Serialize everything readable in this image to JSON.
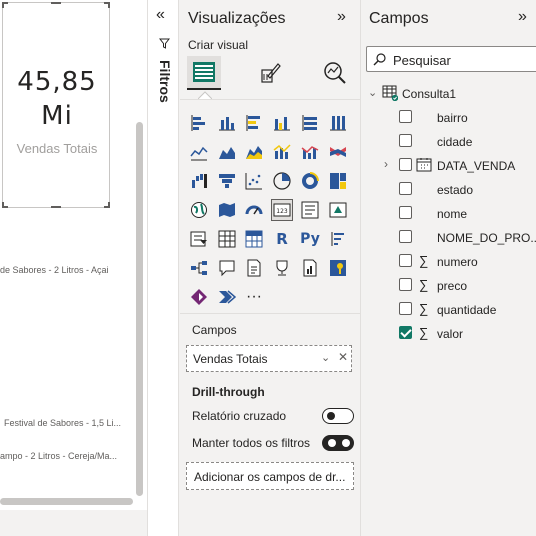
{
  "card": {
    "value_line1": "45,85",
    "value_line2": "Mi",
    "label": "Vendas Totais"
  },
  "chart_labels": [
    "de Sabores - 2 Litros - Açai",
    "Festival de Sabores - 1,5 Li...",
    "ampo - 2 Litros - Cereja/Ma..."
  ],
  "filters": {
    "label": "Filtros",
    "collapse_icon": "double-chevron-left-icon",
    "funnel_icon": "filter-icon"
  },
  "visualizations": {
    "title": "Visualizações",
    "build_label": "Criar visual",
    "wells_label": "Campos",
    "field_in_well": "Vendas Totais",
    "drill_title": "Drill-through",
    "cross_report_label": "Relatório cruzado",
    "cross_report_on": false,
    "keep_filters_label": "Manter todos os filtros",
    "keep_filters_on": true,
    "add_drill_label": "Adicionar os campos de dr...",
    "more_label": "···"
  },
  "fields": {
    "title": "Campos",
    "search_placeholder": "Pesquisar",
    "table_name": "Consulta1",
    "items": [
      {
        "name": "bairro",
        "sigma": false,
        "checked": false
      },
      {
        "name": "cidade",
        "sigma": false,
        "checked": false
      },
      {
        "name": "DATA_VENDA",
        "sigma": false,
        "checked": false,
        "date": true
      },
      {
        "name": "estado",
        "sigma": false,
        "checked": false
      },
      {
        "name": "nome",
        "sigma": false,
        "checked": false
      },
      {
        "name": "NOME_DO_PRO...",
        "sigma": false,
        "checked": false
      },
      {
        "name": "numero",
        "sigma": true,
        "checked": false
      },
      {
        "name": "preco",
        "sigma": true,
        "checked": false
      },
      {
        "name": "quantidade",
        "sigma": true,
        "checked": false
      },
      {
        "name": "valor",
        "sigma": true,
        "checked": true
      }
    ]
  },
  "colors": {
    "accent_green": "#117865",
    "pane_bg": "#f3f2f1",
    "text": "#252423"
  }
}
